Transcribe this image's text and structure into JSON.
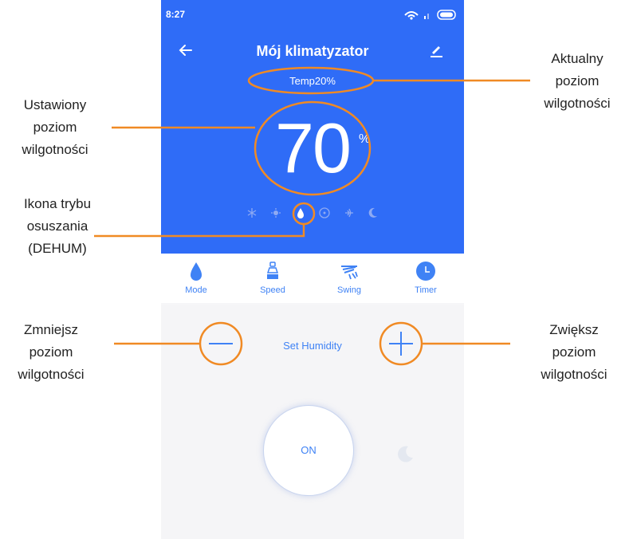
{
  "status_bar": {
    "time": "8:27"
  },
  "header": {
    "title": "Mój klimatyzator"
  },
  "display": {
    "current_humidity": "Temp20%",
    "set_value": "70",
    "unit": "%"
  },
  "mode_icons": [
    "snowflake-icon",
    "sun-icon",
    "drop-icon",
    "fan-icon",
    "auto-icon",
    "moon-icon"
  ],
  "controls": [
    {
      "label": "Mode",
      "icon": "drop-icon"
    },
    {
      "label": "Speed",
      "icon": "speed-icon"
    },
    {
      "label": "Swing",
      "icon": "swing-icon"
    },
    {
      "label": "Timer",
      "icon": "clock-icon"
    }
  ],
  "panel": {
    "set_humidity_label": "Set Humidity",
    "power_label": "ON"
  },
  "callouts": {
    "current": "Aktualny poziom wilgotności",
    "set": "Ustawiony poziom wilgotności",
    "mode": "Ikona trybu osuszania (DEHUM)",
    "decrease": "Zmniejsz poziom wilgotności",
    "increase": "Zwiększ poziom wilgotności"
  },
  "colors": {
    "accent": "#2f6cf7",
    "highlight": "#f08a24",
    "link": "#3f82f5"
  }
}
